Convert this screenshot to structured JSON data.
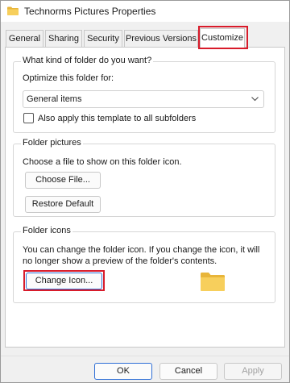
{
  "window": {
    "title": "Technorms Pictures Properties"
  },
  "tabs": [
    {
      "label": "General",
      "active": false
    },
    {
      "label": "Sharing",
      "active": false
    },
    {
      "label": "Security",
      "active": false
    },
    {
      "label": "Previous Versions",
      "active": false
    },
    {
      "label": "Customize",
      "active": true
    }
  ],
  "folder_type": {
    "legend": "What kind of folder do you want?",
    "optimize_label": "Optimize this folder for:",
    "selected": "General items",
    "apply_subfolders_label": "Also apply this template to all subfolders",
    "apply_subfolders_checked": false
  },
  "folder_pictures": {
    "legend": "Folder pictures",
    "description": "Choose a file to show on this folder icon.",
    "choose_file_label": "Choose File...",
    "restore_default_label": "Restore Default"
  },
  "folder_icons": {
    "legend": "Folder icons",
    "description_line1": "You can change the folder icon. If you change the icon, it will",
    "description_line2": "no longer show a preview of the folder's contents.",
    "change_icon_label": "Change Icon..."
  },
  "footer": {
    "ok_label": "OK",
    "cancel_label": "Cancel",
    "apply_label": "Apply"
  },
  "colors": {
    "highlight": "#d81b2a",
    "focus": "#2f6fd6",
    "folder": "#f2c14e"
  },
  "icons": {
    "title_icon": "folder-icon",
    "preview_icon": "folder-icon",
    "dropdown": "chevron-down-icon"
  }
}
